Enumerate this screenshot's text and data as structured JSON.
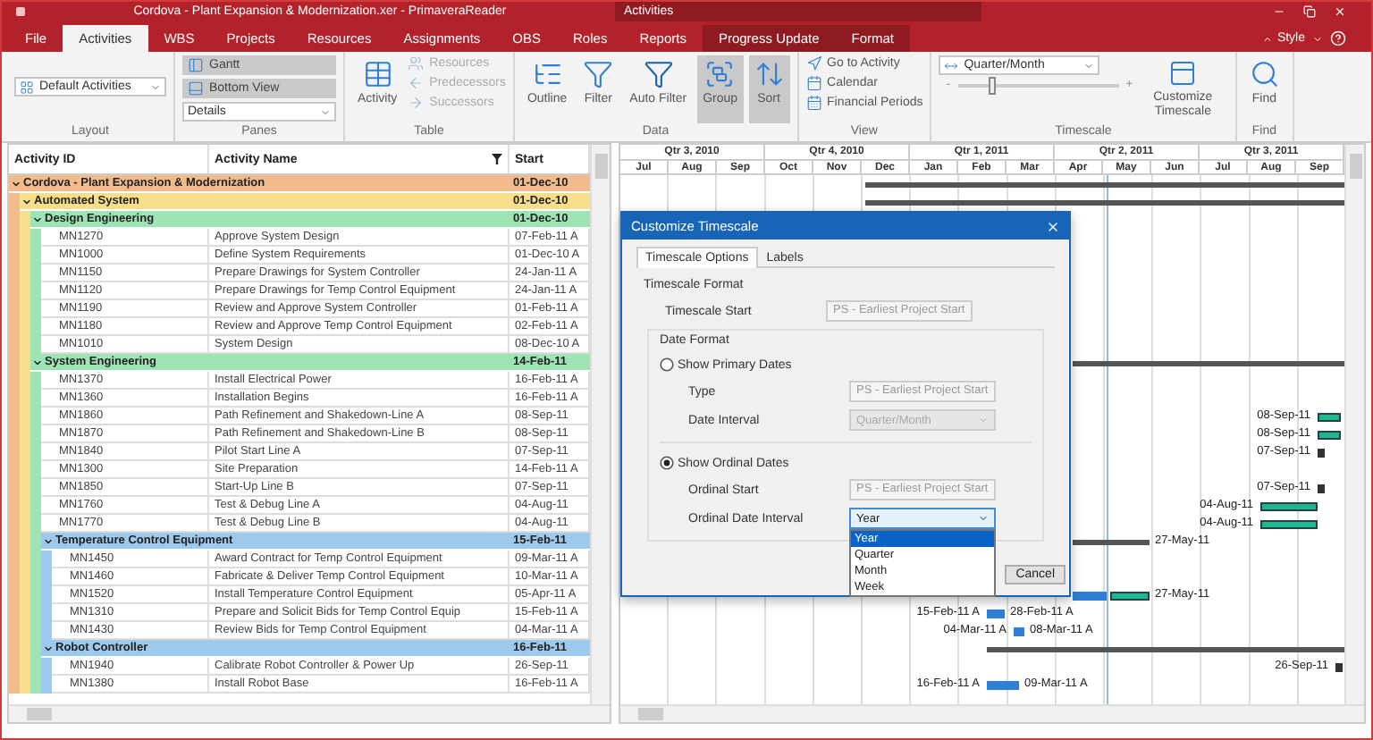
{
  "window": {
    "title": "Cordova - Plant Expansion & Modernization.xer - PrimaveraReader",
    "context_title": "Activities"
  },
  "tabs": [
    {
      "label": "File",
      "selected": false,
      "contextual": false
    },
    {
      "label": "Activities",
      "selected": true,
      "contextual": false
    },
    {
      "label": "WBS",
      "selected": false,
      "contextual": false
    },
    {
      "label": "Projects",
      "selected": false,
      "contextual": false
    },
    {
      "label": "Resources",
      "selected": false,
      "contextual": false
    },
    {
      "label": "Assignments",
      "selected": false,
      "contextual": false
    },
    {
      "label": "OBS",
      "selected": false,
      "contextual": false
    },
    {
      "label": "Roles",
      "selected": false,
      "contextual": false
    },
    {
      "label": "Reports",
      "selected": false,
      "contextual": false
    },
    {
      "label": "Progress Update",
      "selected": false,
      "contextual": true
    },
    {
      "label": "Format",
      "selected": false,
      "contextual": true
    }
  ],
  "style_menu": "Style",
  "ribbon": [
    {
      "label": "Layout",
      "items": [
        {
          "kind": "select",
          "label": "Default Activities"
        }
      ]
    },
    {
      "label": "Panes",
      "items": [
        {
          "kind": "toggle",
          "label": "Gantt",
          "on": true
        },
        {
          "kind": "toggle",
          "label": "Bottom View",
          "on": true
        },
        {
          "kind": "select",
          "label": "Details"
        }
      ]
    },
    {
      "label": "Table",
      "items": [
        {
          "kind": "large",
          "label": "Activity",
          "on": false
        },
        {
          "kind": "small",
          "label": "Resources",
          "disabled": true
        },
        {
          "kind": "small",
          "label": "Predecessors",
          "disabled": true
        },
        {
          "kind": "small",
          "label": "Successors",
          "disabled": true
        }
      ]
    },
    {
      "label": "Data",
      "items": [
        {
          "kind": "large",
          "label": "Outline",
          "on": false
        },
        {
          "kind": "large",
          "label": "Filter",
          "on": false
        },
        {
          "kind": "large",
          "label": "Auto Filter",
          "on": false
        },
        {
          "kind": "large",
          "label": "Group",
          "on": true
        },
        {
          "kind": "large",
          "label": "Sort",
          "on": true
        }
      ]
    },
    {
      "label": "View",
      "items": [
        {
          "kind": "small",
          "label": "Go to Activity",
          "disabled": false
        },
        {
          "kind": "small",
          "label": "Calendar",
          "disabled": false
        },
        {
          "kind": "small",
          "label": "Financial Periods",
          "disabled": false
        }
      ]
    },
    {
      "label": "Timescale",
      "items": [
        {
          "kind": "select",
          "label": "Quarter/Month"
        },
        {
          "kind": "slider",
          "minus": "-",
          "plus": "+",
          "level": 0.2
        },
        {
          "kind": "large",
          "label": "Customize Timescale",
          "on": false
        }
      ]
    },
    {
      "label": "Find",
      "items": [
        {
          "kind": "large",
          "label": "Find",
          "on": false
        }
      ]
    }
  ],
  "table": {
    "columns": [
      "Activity ID",
      "Activity Name",
      "Start"
    ],
    "wbs": [
      {
        "name": "Cordova - Plant Expansion & Modernization",
        "start": "01-Dec-10",
        "color": "#f2bb8c",
        "expanded": true,
        "children": [
          {
            "name": "Automated System",
            "start": "01-Dec-10",
            "color": "#f6de8a",
            "expanded": true,
            "children": [
              {
                "name": "Design Engineering",
                "start": "01-Dec-10",
                "color": "#9ee3b4",
                "expanded": true,
                "activities": [
                  {
                    "id": "MN1270",
                    "name": "Approve System Design",
                    "start": "07-Feb-11 A"
                  },
                  {
                    "id": "MN1000",
                    "name": "Define System Requirements",
                    "start": "01-Dec-10 A"
                  },
                  {
                    "id": "MN1150",
                    "name": "Prepare Drawings for System Controller",
                    "start": "24-Jan-11 A"
                  },
                  {
                    "id": "MN1120",
                    "name": "Prepare Drawings for Temp Control Equipment",
                    "start": "24-Jan-11 A"
                  },
                  {
                    "id": "MN1190",
                    "name": "Review and Approve System Controller",
                    "start": "01-Feb-11 A"
                  },
                  {
                    "id": "MN1180",
                    "name": "Review and Approve Temp Control Equipment",
                    "start": "02-Feb-11 A"
                  },
                  {
                    "id": "MN1010",
                    "name": "System Design",
                    "start": "08-Dec-10 A"
                  }
                ]
              },
              {
                "name": "System Engineering",
                "start": "14-Feb-11",
                "color": "#9ee3b4",
                "expanded": true,
                "activities": [
                  {
                    "id": "MN1370",
                    "name": "Install Electrical Power",
                    "start": "16-Feb-11 A"
                  },
                  {
                    "id": "MN1360",
                    "name": "Installation Begins",
                    "start": "16-Feb-11 A"
                  },
                  {
                    "id": "MN1860",
                    "name": "Path Refinement and Shakedown-Line A",
                    "start": "08-Sep-11"
                  },
                  {
                    "id": "MN1870",
                    "name": "Path Refinement and Shakedown-Line B",
                    "start": "08-Sep-11"
                  },
                  {
                    "id": "MN1840",
                    "name": "Pilot Start Line A",
                    "start": "07-Sep-11"
                  },
                  {
                    "id": "MN1300",
                    "name": "Site Preparation",
                    "start": "14-Feb-11 A"
                  },
                  {
                    "id": "MN1850",
                    "name": "Start-Up Line B",
                    "start": "07-Sep-11"
                  },
                  {
                    "id": "MN1760",
                    "name": "Test & Debug Line A",
                    "start": "04-Aug-11"
                  },
                  {
                    "id": "MN1770",
                    "name": "Test & Debug Line B",
                    "start": "04-Aug-11"
                  }
                ],
                "children": [
                  {
                    "name": "Temperature Control Equipment",
                    "start": "15-Feb-11",
                    "color": "#9cc9ec",
                    "expanded": true,
                    "activities": [
                      {
                        "id": "MN1450",
                        "name": "Award Contract for Temp Control Equipment",
                        "start": "09-Mar-11 A"
                      },
                      {
                        "id": "MN1460",
                        "name": "Fabricate & Deliver Temp Control Equipment",
                        "start": "10-Mar-11 A"
                      },
                      {
                        "id": "MN1520",
                        "name": "Install Temperature Control Equipment",
                        "start": "05-Apr-11 A"
                      },
                      {
                        "id": "MN1310",
                        "name": "Prepare and Solicit Bids for Temp Control Equip",
                        "start": "15-Feb-11 A"
                      },
                      {
                        "id": "MN1430",
                        "name": "Review Bids for Temp Control Equipment",
                        "start": "04-Mar-11 A"
                      }
                    ]
                  },
                  {
                    "name": "Robot Controller",
                    "start": "16-Feb-11",
                    "color": "#9cc9ec",
                    "expanded": true,
                    "activities": [
                      {
                        "id": "MN1940",
                        "name": "Calibrate Robot Controller & Power Up",
                        "start": "26-Sep-11"
                      },
                      {
                        "id": "MN1380",
                        "name": "Install Robot Base",
                        "start": "16-Feb-11 A"
                      }
                    ]
                  }
                ]
              }
            ]
          }
        ]
      }
    ]
  },
  "gantt": {
    "quarters": [
      "Qtr 3, 2010",
      "Qtr 4, 2010",
      "Qtr 1, 2011",
      "Qtr 2, 2011",
      "Qtr 3, 2011"
    ],
    "months": [
      "Jul",
      "Aug",
      "Sep",
      "Oct",
      "Nov",
      "Dec",
      "Jan",
      "Feb",
      "Mar",
      "Apr",
      "May",
      "Jun",
      "Jul",
      "Aug",
      "Sep"
    ],
    "bars": [
      {
        "kind": "summary"
      },
      {
        "kind": "summary"
      },
      {
        "kind": "summary"
      },
      {
        "kind": "remaining",
        "before": "08-Sep-11"
      },
      {
        "kind": "remaining",
        "before": "08-Sep-11"
      },
      {
        "kind": "milestone",
        "before": "07-Sep-11"
      },
      {
        "kind": "milestone",
        "before": "07-Sep-11"
      },
      {
        "kind": "remaining",
        "before": "04-Aug-11"
      },
      {
        "kind": "remaining",
        "before": "04-Aug-11"
      },
      {
        "kind": "summary",
        "after": "27-May-11"
      },
      {
        "kind": "actual"
      },
      {
        "kind": "remaining",
        "after": "27-May-11"
      },
      {
        "kind": "actual",
        "before": "15-Feb-11 A",
        "after": "28-Feb-11 A"
      },
      {
        "kind": "actual",
        "before": "04-Mar-11 A",
        "after": "08-Mar-11 A"
      },
      {
        "kind": "summary"
      },
      {
        "kind": "milestone",
        "before": "26-Sep-11"
      },
      {
        "kind": "actual",
        "before": "16-Feb-11 A",
        "after": "09-Mar-11 A"
      }
    ]
  },
  "dialog": {
    "title": "Customize Timescale",
    "tabs": [
      {
        "label": "Timescale Options",
        "selected": true
      },
      {
        "label": "Labels",
        "selected": false
      }
    ],
    "timescale_format": {
      "legend": "Timescale Format",
      "label": "Timescale Start",
      "value": "PS - Earliest Project Start"
    },
    "date_format": {
      "legend": "Date Format",
      "primary": {
        "label": "Show Primary Dates",
        "selected": false,
        "type_label": "Type",
        "type_value": "PS - Earliest Project Start",
        "interval_label": "Date Interval",
        "interval_value": "Quarter/Month"
      },
      "ordinal": {
        "label": "Show Ordinal Dates",
        "selected": true,
        "start_label": "Ordinal Start",
        "start_value": "PS - Earliest Project Start",
        "interval_label": "Ordinal Date Interval",
        "interval_value": "Year",
        "options": [
          {
            "label": "Year",
            "selected": true
          },
          {
            "label": "Quarter",
            "selected": false
          },
          {
            "label": "Month",
            "selected": false
          },
          {
            "label": "Week",
            "selected": false
          }
        ]
      }
    },
    "buttons": [
      "Cancel"
    ]
  }
}
